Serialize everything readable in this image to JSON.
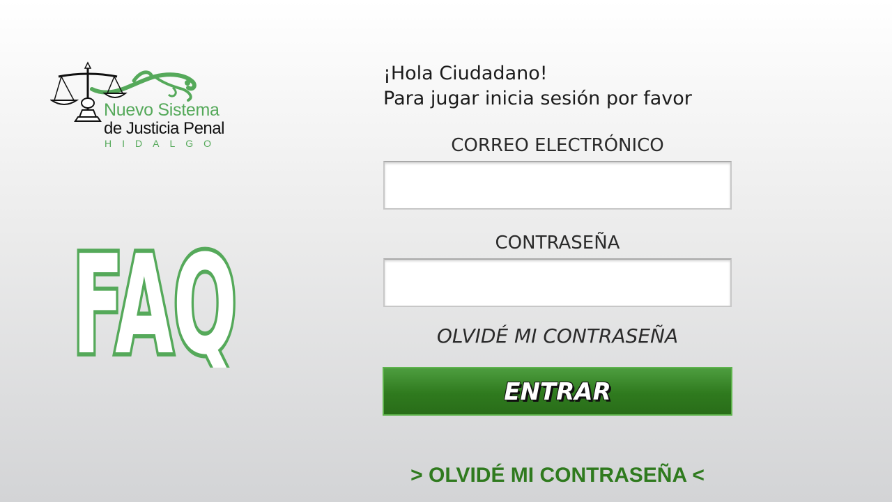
{
  "logo": {
    "line1": "Nuevo Sistema",
    "line2": "de Justicia Penal",
    "line3": "HIDALGO"
  },
  "faq": {
    "label": "FAQ"
  },
  "greeting": {
    "line1": "¡Hola Ciudadano!",
    "line2": "Para jugar inicia sesión por favor"
  },
  "form": {
    "email_label": "CORREO ELECTRÓNICO",
    "email_value": "",
    "password_label": "CONTRASEÑA",
    "password_value": "",
    "forgot_label": "OLVIDÉ MI CONTRASEÑA",
    "submit_label": "ENTRAR",
    "forgot_link": "> OLVIDÉ MI CONTRASEÑA <"
  },
  "colors": {
    "accent_green": "#2f7a1e",
    "logo_green": "#55a95a",
    "faq_green": "#55a95a"
  }
}
